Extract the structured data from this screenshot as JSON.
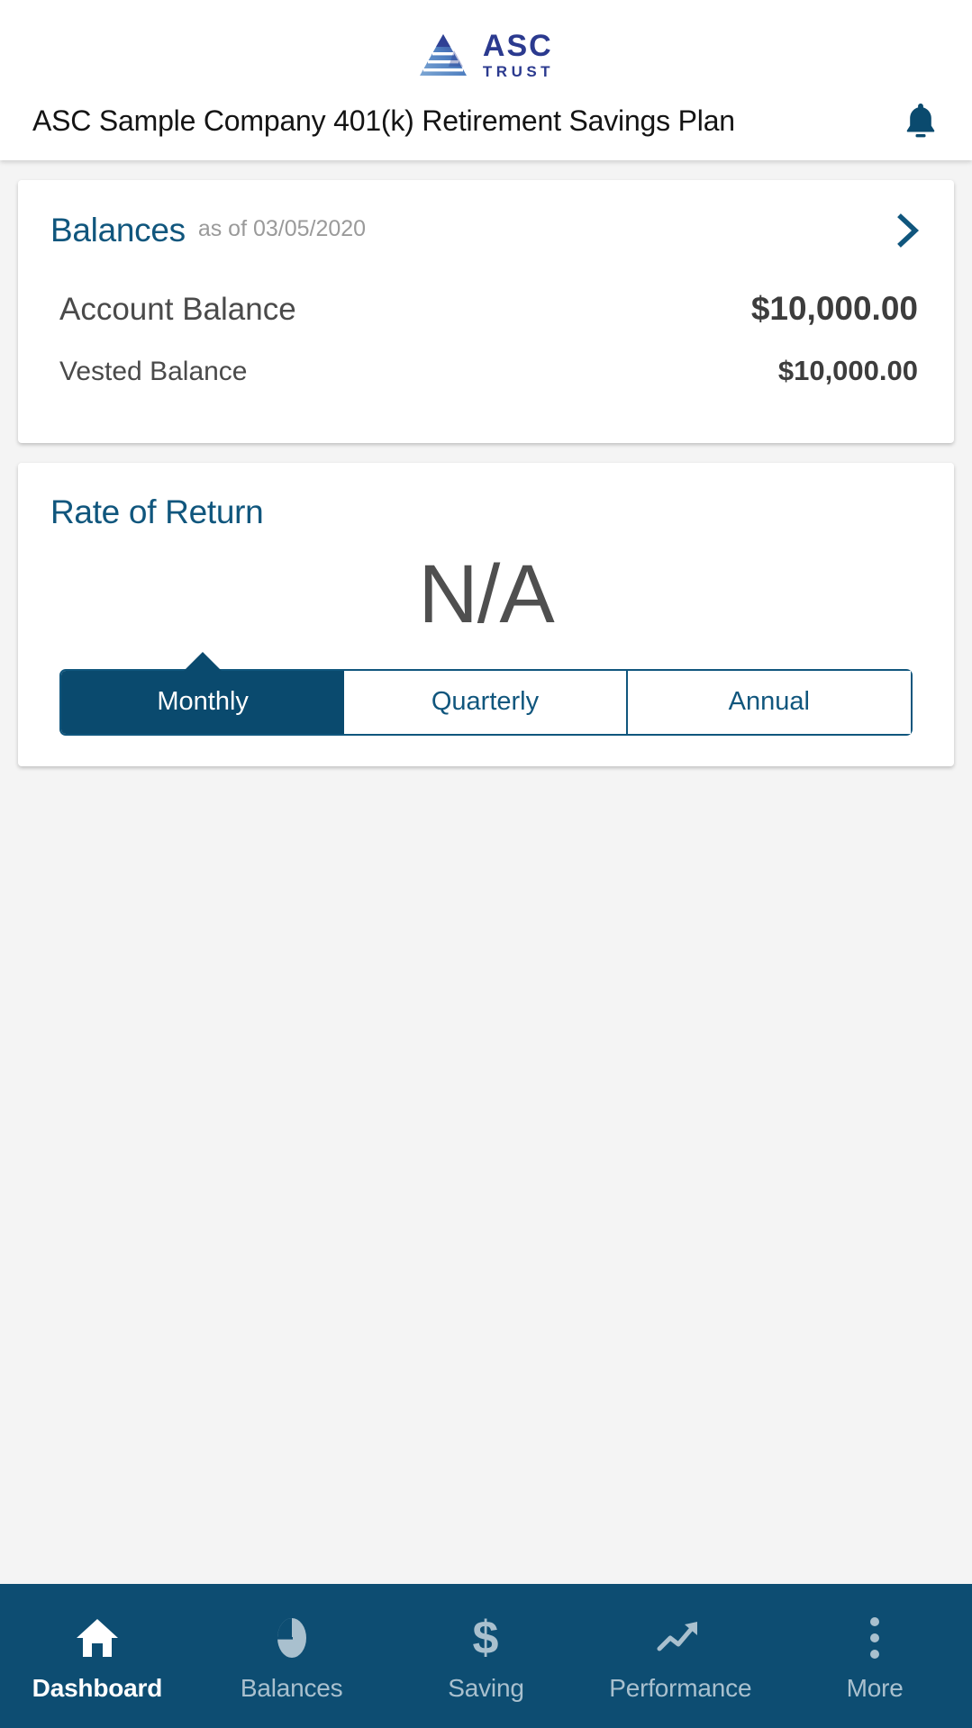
{
  "header": {
    "logo": {
      "mark": "asc-pyramid-logo",
      "line1": "ASC",
      "line2": "TRUST"
    },
    "plan_title": "ASC Sample Company 401(k) Retirement Savings Plan",
    "notification_icon": "bell-icon"
  },
  "balances_card": {
    "title": "Balances",
    "as_of": "as of 03/05/2020",
    "chevron_icon": "chevron-right-icon",
    "rows": [
      {
        "label": "Account Balance",
        "value": "$10,000.00"
      },
      {
        "label": "Vested Balance",
        "value": "$10,000.00"
      }
    ]
  },
  "rate_of_return_card": {
    "title": "Rate of Return",
    "value": "N/A",
    "periods": [
      {
        "label": "Monthly",
        "selected": true
      },
      {
        "label": "Quarterly",
        "selected": false
      },
      {
        "label": "Annual",
        "selected": false
      }
    ]
  },
  "bottom_nav": [
    {
      "label": "Dashboard",
      "icon": "home-icon",
      "active": true
    },
    {
      "label": "Balances",
      "icon": "pie-chart-icon",
      "active": false
    },
    {
      "label": "Saving",
      "icon": "dollar-sign-icon",
      "active": false
    },
    {
      "label": "Performance",
      "icon": "trending-up-icon",
      "active": false
    },
    {
      "label": "More",
      "icon": "more-vertical-icon",
      "active": false
    }
  ],
  "colors": {
    "brand_navy": "#2b3a8f",
    "accent_teal": "#10567d",
    "nav_background": "#0d4d72",
    "selected_segment": "#0a4a6e",
    "page_background": "#f4f4f4",
    "muted_text": "#9a9a9a"
  }
}
